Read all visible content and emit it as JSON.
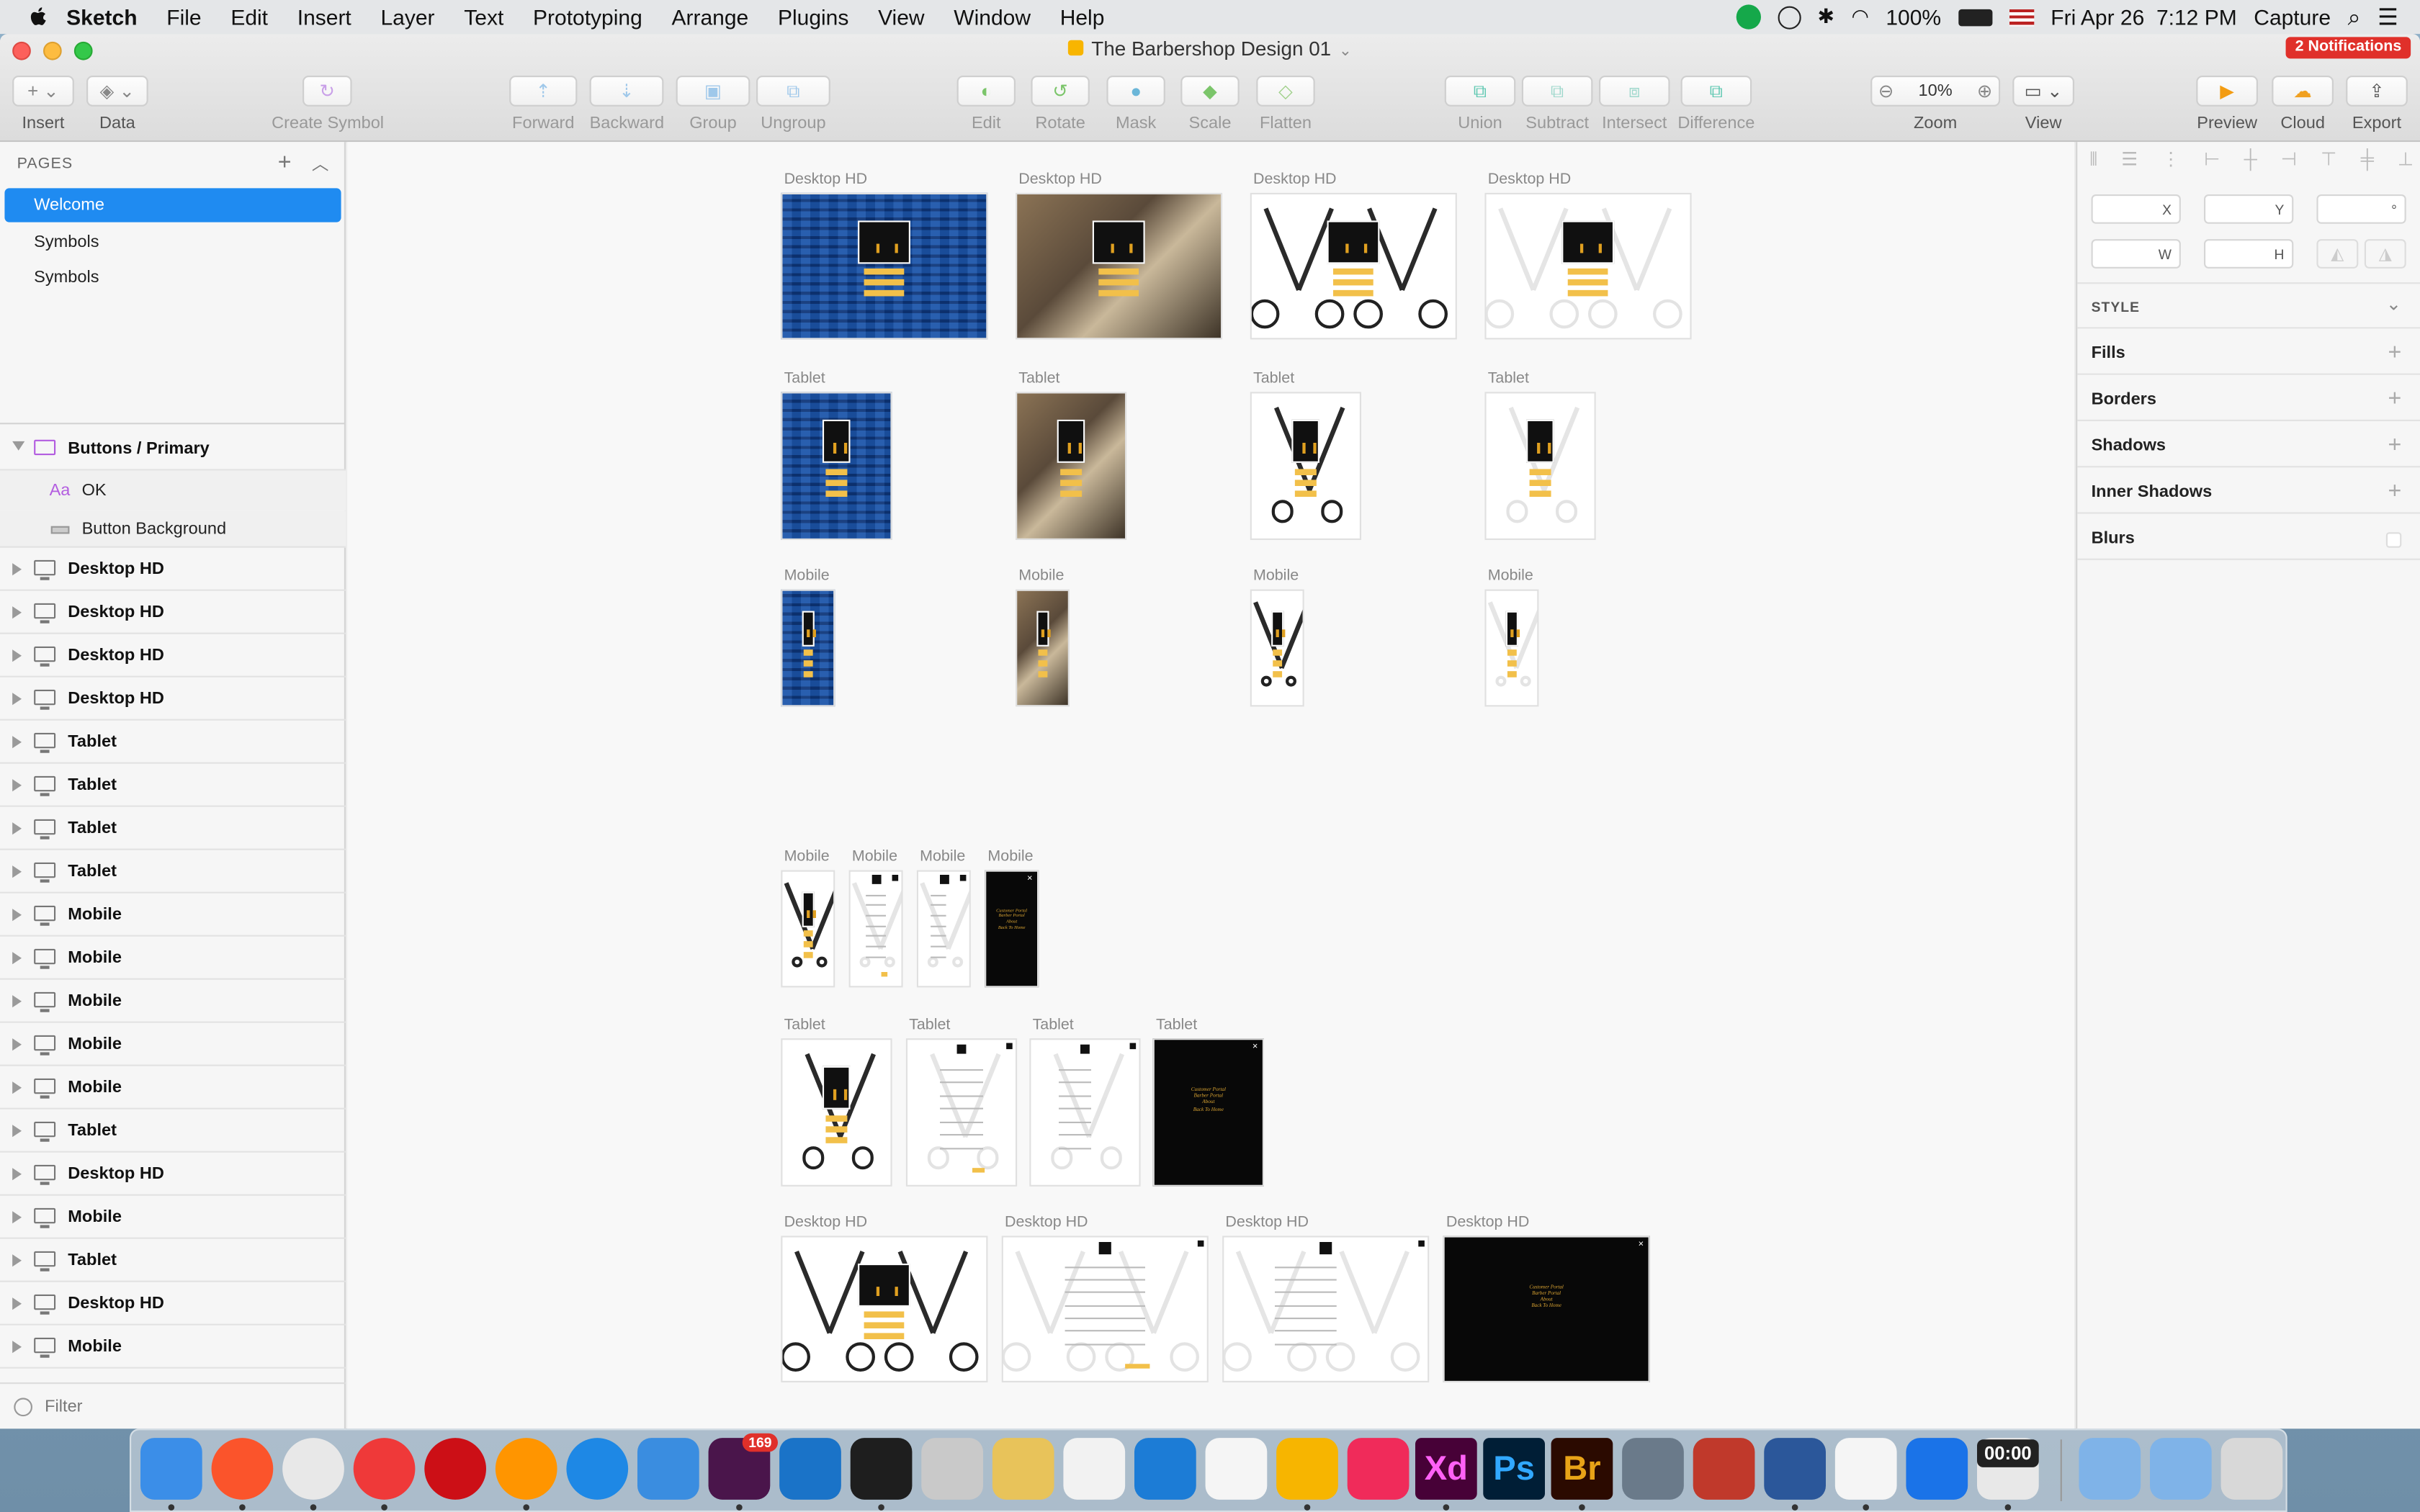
{
  "menubar": {
    "app": "Sketch",
    "items": [
      "File",
      "Edit",
      "Insert",
      "Layer",
      "Text",
      "Prototyping",
      "Arrange",
      "Plugins",
      "View",
      "Window",
      "Help"
    ],
    "battery": "100%",
    "datetime": "Fri Apr 26  7:12 PM",
    "capture": "Capture"
  },
  "window": {
    "title": "The Barbershop Design 01",
    "notifications": "2 Notifications"
  },
  "toolbar": {
    "insert": "Insert",
    "data": "Data",
    "create_symbol": "Create Symbol",
    "forward": "Forward",
    "backward": "Backward",
    "group": "Group",
    "ungroup": "Ungroup",
    "edit": "Edit",
    "rotate": "Rotate",
    "mask": "Mask",
    "scale": "Scale",
    "flatten": "Flatten",
    "union": "Union",
    "subtract": "Subtract",
    "intersect": "Intersect",
    "difference": "Difference",
    "zoom_value": "10%",
    "zoom": "Zoom",
    "view": "View",
    "preview": "Preview",
    "cloud": "Cloud",
    "export": "Export"
  },
  "pages": {
    "header": "PAGES",
    "items": [
      "Welcome",
      "Symbols",
      "Symbols"
    ]
  },
  "layers": {
    "group": "Buttons / Primary",
    "children": [
      {
        "icon": "text-layer-icon",
        "glyph": "Aa",
        "label": "OK"
      },
      {
        "icon": "rectangle-layer-icon",
        "label": "Button Background"
      }
    ],
    "artboards": [
      "Desktop HD",
      "Desktop HD",
      "Desktop HD",
      "Desktop HD",
      "Tablet",
      "Tablet",
      "Tablet",
      "Tablet",
      "Mobile",
      "Mobile",
      "Mobile",
      "Mobile",
      "Mobile",
      "Tablet",
      "Desktop HD",
      "Mobile",
      "Tablet",
      "Desktop HD",
      "Mobile"
    ],
    "filter": "Filter"
  },
  "canvas": {
    "labels": {
      "desktop": "Desktop HD",
      "tablet": "Tablet",
      "mobile": "Mobile"
    },
    "menu_text": [
      "Customer Portal",
      "Barber Portal",
      "About",
      "Back To Home"
    ]
  },
  "inspector": {
    "x": "X",
    "y": "Y",
    "deg": "°",
    "w": "W",
    "h": "H",
    "style": "STYLE",
    "sections": [
      "Fills",
      "Borders",
      "Shadows",
      "Inner Shadows",
      "Blurs"
    ]
  },
  "dock": {
    "badge": "169",
    "clock": "00:00",
    "apps": [
      "finder-icon",
      "brave-icon",
      "chrome-icon",
      "vivaldi-icon",
      "opera-icon",
      "firefox-icon",
      "safari-icon",
      "markdown-icon",
      "slack-icon",
      "vscode-icon",
      "terminal-icon",
      "tableplus-icon",
      "sequel-icon",
      "paw-icon",
      "xcode-icon",
      "clock-icon",
      "sketch-icon",
      "scrivener-icon",
      "xd-icon",
      "photoshop-icon",
      "bridge-icon",
      "colorsync-icon",
      "photo-booth-icon",
      "word-icon",
      "textedit-icon",
      "keynote-icon",
      "activity-monitor-icon",
      "app-store-folder-icon",
      "downloads-folder-icon",
      "trash-icon"
    ]
  },
  "colors": {
    "selection": "#1f8bf1",
    "notification": "#e0302a",
    "gold": "#d9a332"
  }
}
